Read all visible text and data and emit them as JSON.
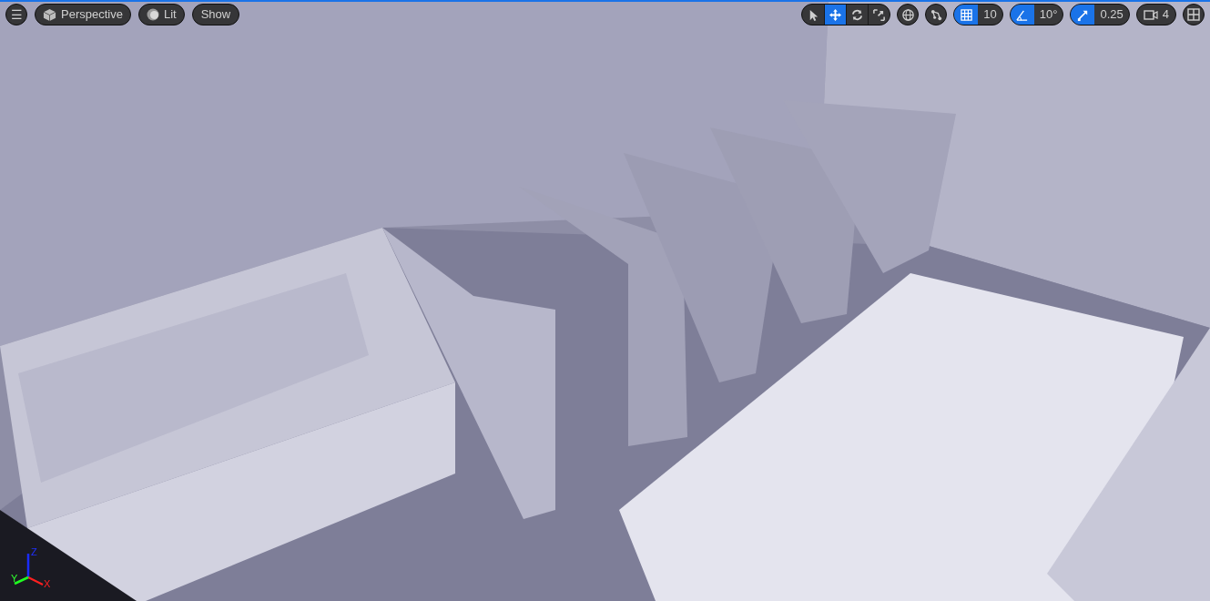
{
  "viewport": {
    "active": true
  },
  "left_toolbar": {
    "menu": {
      "glyph": "☰"
    },
    "view_mode": {
      "label": "Perspective"
    },
    "lighting": {
      "label": "Lit"
    },
    "show": {
      "label": "Show"
    }
  },
  "transform_tools": [
    {
      "kind": "select",
      "selected": false
    },
    {
      "kind": "move",
      "selected": true
    },
    {
      "kind": "rotate",
      "selected": false
    },
    {
      "kind": "scale",
      "selected": false
    }
  ],
  "coordinate_space": {
    "kind": "world"
  },
  "surface_snapping": {
    "on": false
  },
  "snaps": [
    {
      "kind": "grid",
      "on": true,
      "value": "10"
    },
    {
      "kind": "angle",
      "on": true,
      "value": "10°"
    },
    {
      "kind": "scale",
      "on": true,
      "value": "0.25"
    }
  ],
  "camera_speed": {
    "value": "4"
  },
  "axis_gizmo": {
    "x": "X",
    "y": "Y",
    "z": "Z"
  }
}
